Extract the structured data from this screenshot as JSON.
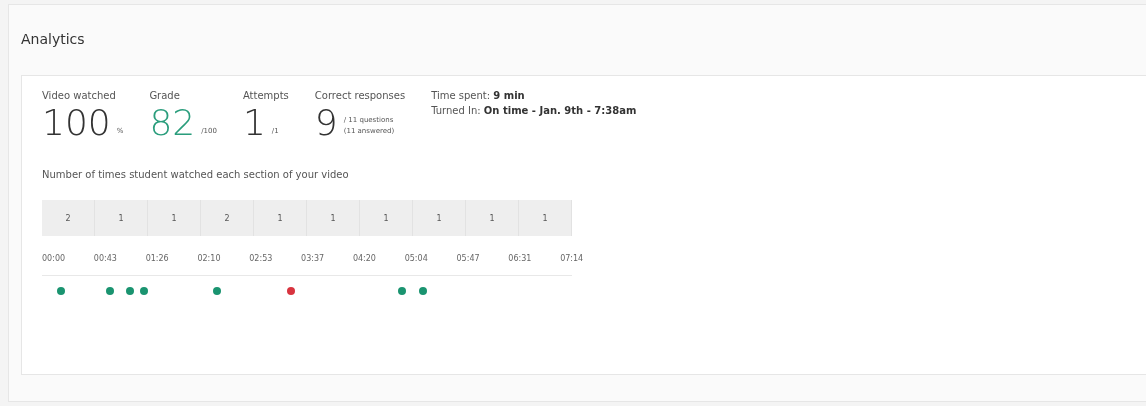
{
  "title": "Analytics",
  "stats": [
    {
      "label": "Video watched",
      "value": "100",
      "unit": "%",
      "kind": "plain"
    },
    {
      "label": "Grade",
      "value": "82",
      "unit": "/100",
      "kind": "accent"
    },
    {
      "label": "Attempts",
      "value": "1",
      "unit": "/1",
      "kind": "plain"
    },
    {
      "label": "Correct responses",
      "value": "9",
      "unit": "/ 11 questions",
      "note": "(11 answered)",
      "kind": "plain"
    }
  ],
  "info": [
    "Time spent: **9 min**",
    "Turned In: **On time - Jan. 9th - 7:38am**"
  ],
  "sections_caption": "Number of times student watched each section of your video",
  "counts": [
    "2",
    "1",
    "1",
    "2",
    "1",
    "1",
    "1",
    "1",
    "1",
    "1"
  ],
  "times": [
    "00:00",
    "00:43",
    "01:26",
    "02:10",
    "02:53",
    "03:37",
    "04:20",
    "05:04",
    "05:47",
    "06:31",
    "07:14"
  ],
  "markers": [
    {
      "level": 0.036,
      "color": "#1a9470"
    },
    {
      "level": 0.128,
      "color": "#1a9470"
    },
    {
      "level": 0.166,
      "color": "#1a9470"
    },
    {
      "level": 0.192,
      "color": "#1a9470"
    },
    {
      "level": 0.33,
      "color": "#1a9470"
    },
    {
      "level": 0.47,
      "color": "#d8343f"
    },
    {
      "level": 0.679,
      "color": "#1a9470"
    },
    {
      "level": 0.719,
      "color": "#1a9470"
    }
  ]
}
